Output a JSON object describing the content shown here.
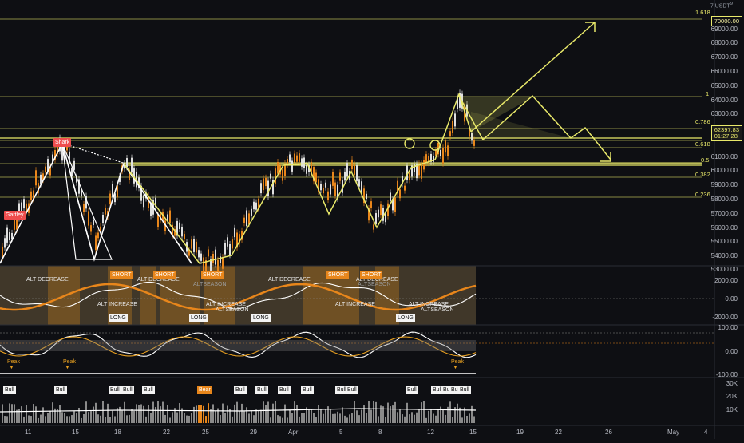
{
  "header": {
    "top_right": "7 USDT",
    "top_right_sup": "9"
  },
  "price_axis": [
    "69000.00",
    "68000.00",
    "67000.00",
    "66000.00",
    "65000.00",
    "64000.00",
    "63000.00",
    "61000.00",
    "60000.00",
    "59000.00",
    "58000.00",
    "57000.00",
    "56000.00",
    "55000.00",
    "54000.00",
    "53000.00"
  ],
  "price_boxes": {
    "target": "70000.00",
    "current": "62397.83",
    "countdown": "01:27:28"
  },
  "fib_labels": [
    "1.618",
    "1",
    "0.786",
    "0.618",
    "0.5",
    "0.382",
    "0.236"
  ],
  "pattern_labels": {
    "gartley_1": "Shark",
    "gartley_2": "Gartley"
  },
  "osc1_axis": [
    "2000.00",
    "0.00",
    "-2000.00"
  ],
  "osc2_axis": [
    "100.00",
    "0.00",
    "-100.00"
  ],
  "vol_axis": [
    "30K",
    "20K",
    "10K"
  ],
  "date_axis": [
    "11",
    "15",
    "18",
    "22",
    "25",
    "29",
    "Apr",
    "5",
    "8",
    "12",
    "15",
    "19",
    "22",
    "26",
    "May",
    "4"
  ],
  "osc1_texts": {
    "alt_decrease_1": "ALT DECREASE",
    "alt_decrease_2": "ALT DECREASE",
    "alt_decrease_3": "ALT DECREASE",
    "alt_decrease_4": "ALT DECREASE",
    "alt_increase_1": "ALT INCREASE",
    "alt_increase_2": "ALT INCREASE",
    "alt_increase_3": "ALT INCREASE",
    "alt_increase_4": "ALT INCREASE",
    "altseason_1": "ALTSEASON",
    "altseason_2": "ALTSEASON",
    "altseason_3": "ALTSEASON",
    "altseason_4": "ALTSEASON",
    "short": "SHORT",
    "long": "LONG"
  },
  "peak_label": "Peak",
  "bull_label": "Bull",
  "bear_label": "Bear",
  "colors": {
    "fib": "#e9e96a",
    "pattern": "#ffffff",
    "short": "#e8861b",
    "background": "#0e0f13"
  }
}
